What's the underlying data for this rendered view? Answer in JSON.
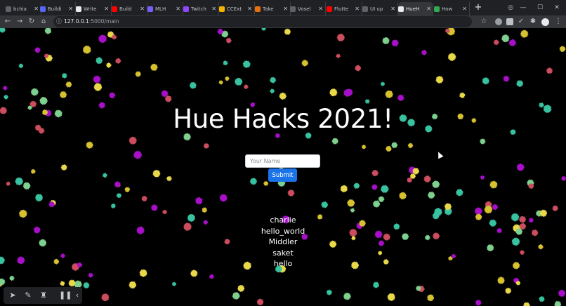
{
  "browser": {
    "tabs": [
      {
        "label": "bchia",
        "color": "#5f6368"
      },
      {
        "label": "Buildi",
        "color": "#5865f2"
      },
      {
        "label": "Write",
        "color": "#e8eaed"
      },
      {
        "label": "Build",
        "color": "#ff0000"
      },
      {
        "label": "MLH",
        "color": "#7b5cff"
      },
      {
        "label": "Twitch",
        "color": "#9146ff"
      },
      {
        "label": "CCExt",
        "color": "#f4b400"
      },
      {
        "label": "Take",
        "color": "#e8710a"
      },
      {
        "label": "Vosel",
        "color": "#5f6368"
      },
      {
        "label": "Flutte",
        "color": "#ff0000"
      },
      {
        "label": "UI up",
        "color": "#5f6368"
      },
      {
        "label": "HueH",
        "color": "#e8eaed"
      },
      {
        "label": "How",
        "color": "#34a853"
      }
    ],
    "active_tab": 11,
    "new_tab": "+",
    "url_host": "127.0.0.1",
    "url_rest": ":5000/main"
  },
  "page": {
    "title": "Hue Hacks 2021!",
    "input_placeholder": "Your Name",
    "submit_label": "Submit",
    "names": [
      "charlie",
      "hello_world",
      "Middler",
      "saket",
      "hello"
    ]
  },
  "colors": {
    "confetti": [
      "#39c2a0",
      "#d6c131",
      "#a80fc9",
      "#cc4d5e",
      "#e8d84a",
      "#7ed08f"
    ],
    "accent": "#1a73e8"
  }
}
